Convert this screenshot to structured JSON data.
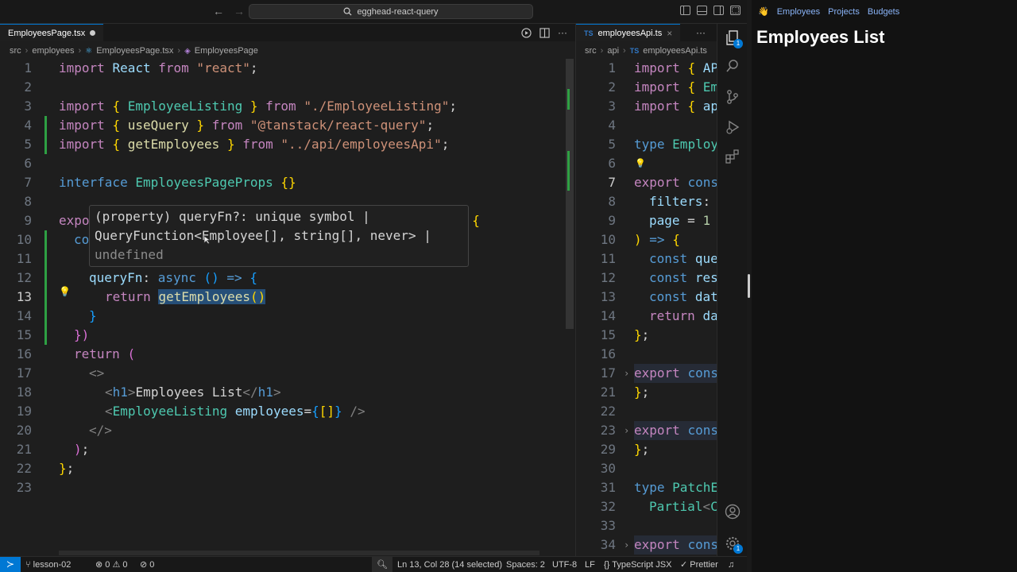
{
  "titlebar": {
    "back_arrow": "←",
    "forward_arrow": "→",
    "search_text": "egghead-react-query"
  },
  "left_editor": {
    "tab": {
      "label": "EmployeesPage.tsx"
    },
    "breadcrumbs": [
      "src",
      "employees",
      "EmployeesPage.tsx",
      "EmployeesPage"
    ],
    "lines": [
      {
        "n": "1"
      },
      {
        "n": "2"
      },
      {
        "n": "3"
      },
      {
        "n": "4"
      },
      {
        "n": "5"
      },
      {
        "n": "6"
      },
      {
        "n": "7"
      },
      {
        "n": "8"
      },
      {
        "n": "9"
      },
      {
        "n": "10"
      },
      {
        "n": "11"
      },
      {
        "n": "12"
      },
      {
        "n": "13"
      },
      {
        "n": "14"
      },
      {
        "n": "15"
      },
      {
        "n": "16"
      },
      {
        "n": "17"
      },
      {
        "n": "18"
      },
      {
        "n": "19"
      },
      {
        "n": "20"
      },
      {
        "n": "21"
      },
      {
        "n": "22"
      },
      {
        "n": "23"
      }
    ],
    "hover": {
      "line1": "(property) queryFn?: unique symbol |",
      "line2": "QueryFunction<Employee[], string[], never> |",
      "line3": "undefined"
    }
  },
  "right_editor": {
    "tab": {
      "label": "employeesApi.ts",
      "badge": "TS"
    },
    "breadcrumbs": [
      "src",
      "api",
      "employeesApi.ts"
    ],
    "lines": [
      "1",
      "2",
      "3",
      "4",
      "5",
      "6",
      "7",
      "8",
      "9",
      "10",
      "11",
      "12",
      "13",
      "14",
      "15",
      "16",
      "17",
      "21",
      "22",
      "23",
      "29",
      "30",
      "31",
      "32",
      "33",
      "34"
    ]
  },
  "activity": {
    "explorer_badge": "1",
    "settings_badge": "1"
  },
  "statusbar": {
    "branch": "lesson-02",
    "problems": "⊗ 0 ⚠ 0",
    "ports": "⊘ 0",
    "position": "Ln 13, Col 28 (14 selected)",
    "spaces": "Spaces: 2",
    "encoding": "UTF-8",
    "eol": "LF",
    "language": "TypeScript JSX",
    "formatter": "Prettier"
  },
  "preview": {
    "nav": [
      "Employees",
      "Projects",
      "Budgets"
    ],
    "title": "Employees List"
  }
}
